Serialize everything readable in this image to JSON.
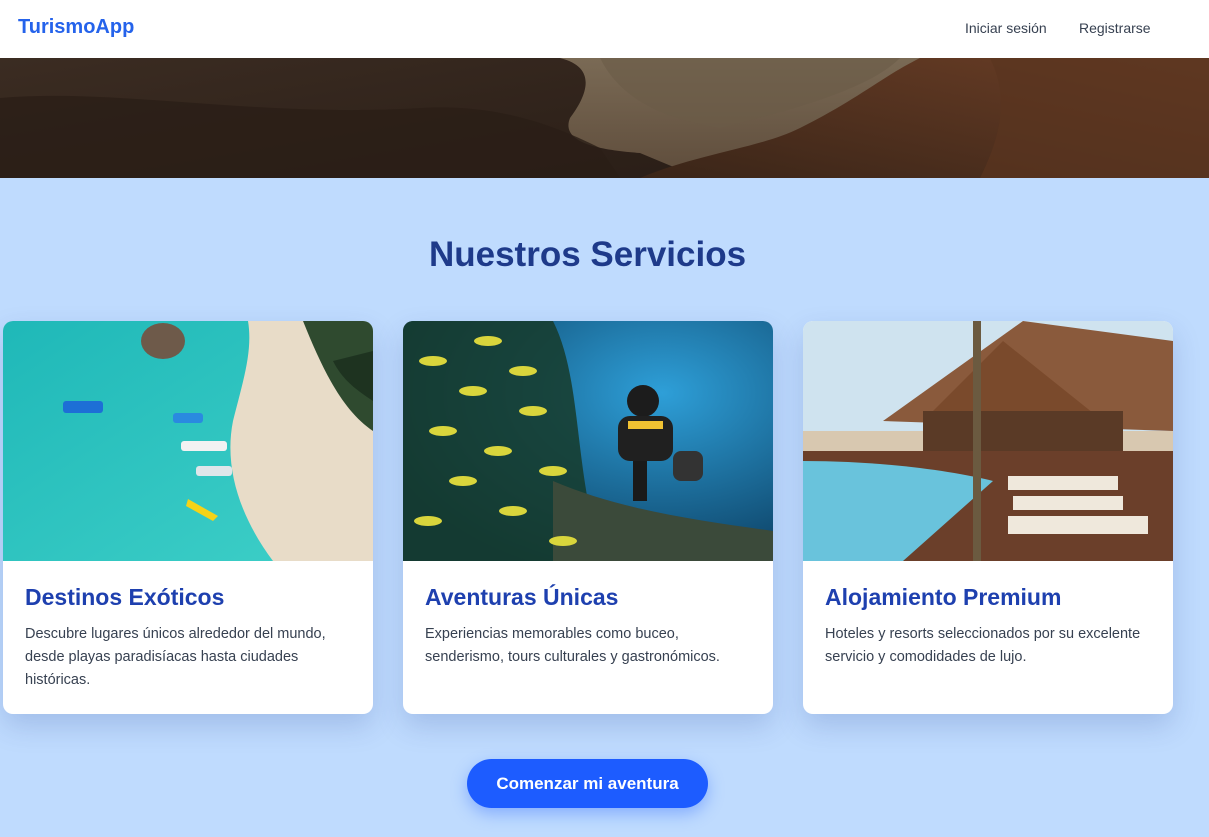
{
  "nav": {
    "brand": "TurismoApp",
    "login_label": "Iniciar sesión",
    "register_label": "Registrarse"
  },
  "hero": {
    "slide_count": 3,
    "active_slide": 1
  },
  "services": {
    "title": "Nuestros Servicios",
    "cards": [
      {
        "title": "Destinos Exóticos",
        "text": "Descubre lugares únicos alrededor del mundo, desde playas paradisíacas hasta ciudades históricas.",
        "image": "tropical-beach-boats-aerial"
      },
      {
        "title": "Aventuras Únicas",
        "text": "Experiencias memorables como buceo, senderismo, tours culturales y gastronómicos.",
        "image": "scuba-diver-fish-school"
      },
      {
        "title": "Alojamiento Premium",
        "text": "Hoteles y resorts seleccionados por su excelente servicio y comodidades de lujo.",
        "image": "resort-pool-loungers"
      }
    ]
  },
  "cta": {
    "label": "Comenzar mi aventura"
  },
  "colors": {
    "brand": "#2563eb",
    "background": "#bfdbfe",
    "heading": "#1e3a8a",
    "card_title": "#1e40af",
    "cta": "#1d5cff"
  }
}
